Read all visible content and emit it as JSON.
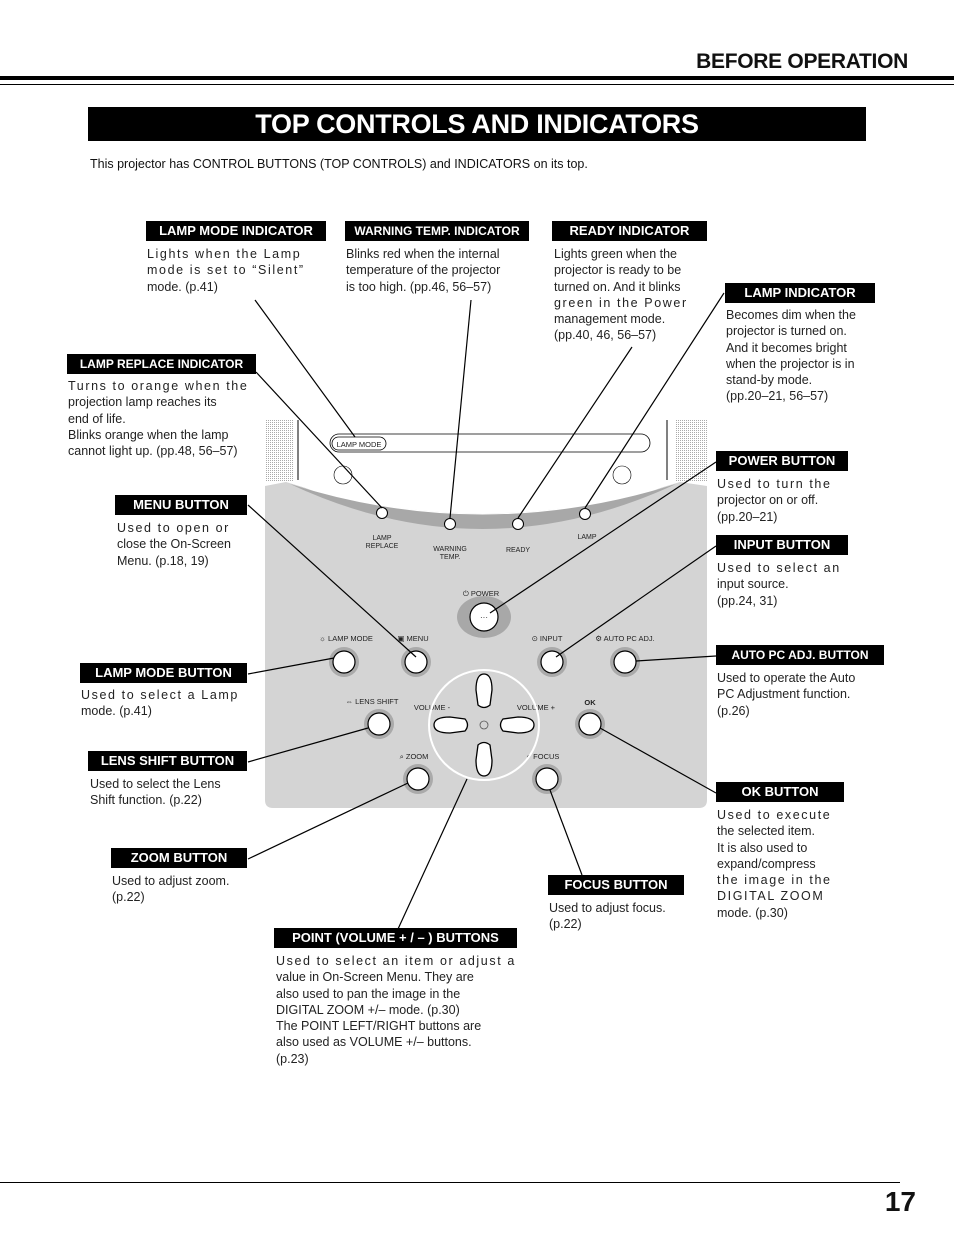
{
  "header": {
    "section": "BEFORE OPERATION"
  },
  "title": "TOP CONTROLS AND INDICATORS",
  "intro": "This projector has CONTROL BUTTONS (TOP CONTROLS) and INDICATORS on its top.",
  "callouts": {
    "lamp_mode_indicator": {
      "label": "LAMP MODE INDICATOR",
      "lines": [
        "Lights when the Lamp",
        "mode is set to “Silent”",
        "mode. (p.41)"
      ]
    },
    "warning_temp_indicator": {
      "label": "WARNING TEMP. INDICATOR",
      "lines": [
        "Blinks red when the internal",
        "temperature of the projector",
        "is too high. (pp.46, 56–57)"
      ]
    },
    "ready_indicator": {
      "label": "READY INDICATOR",
      "lines": [
        "Lights green when the",
        "projector is ready to be",
        "turned on. And it blinks",
        "green in the Power",
        "management mode.",
        "(pp.40, 46, 56–57)"
      ]
    },
    "lamp_indicator": {
      "label": "LAMP INDICATOR",
      "lines": [
        "Becomes dim when the",
        "projector is turned on.",
        "And it becomes bright",
        "when the projector is in",
        "stand-by mode.",
        "(pp.20–21, 56–57)"
      ]
    },
    "lamp_replace_indicator": {
      "label": "LAMP REPLACE INDICATOR",
      "lines": [
        "Turns to orange when the",
        "projection lamp reaches its",
        "end of life.",
        "Blinks orange when the lamp",
        "cannot light up. (pp.48, 56–57)"
      ]
    },
    "menu_button": {
      "label": "MENU BUTTON",
      "lines": [
        "Used to open or",
        "close the On-Screen",
        "Menu. (p.18, 19)"
      ]
    },
    "power_button": {
      "label": "POWER BUTTON",
      "lines": [
        "Used to turn the",
        "projector on or off.",
        "(pp.20–21)"
      ]
    },
    "input_button": {
      "label": "INPUT BUTTON",
      "lines": [
        "Used to select an",
        "input source.",
        "(pp.24, 31)"
      ]
    },
    "lamp_mode_button": {
      "label": "LAMP MODE BUTTON",
      "lines": [
        "Used to select a Lamp",
        "mode. (p.41)"
      ]
    },
    "auto_pc_adj_button": {
      "label": "AUTO PC ADJ. BUTTON",
      "lines": [
        "Used to operate the Auto",
        "PC Adjustment function.",
        "(p.26)"
      ]
    },
    "lens_shift_button": {
      "label": "LENS SHIFT BUTTON",
      "lines": [
        "Used to select the Lens",
        "Shift function. (p.22)"
      ]
    },
    "ok_button": {
      "label": "OK BUTTON",
      "lines": [
        "Used to execute",
        "the selected item.",
        "It is also used to",
        "expand/compress",
        "the image in the",
        "DIGITAL ZOOM",
        "mode. (p.30)"
      ]
    },
    "zoom_button": {
      "label": "ZOOM BUTTON",
      "lines": [
        "Used to adjust zoom.",
        "(p.22)"
      ]
    },
    "focus_button": {
      "label": "FOCUS BUTTON",
      "lines": [
        "Used to adjust focus.",
        "(p.22)"
      ]
    },
    "point_buttons": {
      "label": "POINT (VOLUME + / – ) BUTTONS",
      "lines": [
        "Used to select an item or adjust a",
        "value in On-Screen Menu. They are",
        "also used to pan the image in the",
        "DIGITAL ZOOM +/– mode. (p.30)",
        "The POINT LEFT/RIGHT buttons are",
        "also used as VOLUME +/– buttons.",
        "(p.23)"
      ]
    }
  },
  "panel": {
    "lamp_mode_badge": "LAMP MODE",
    "indicators": {
      "lamp_replace": [
        "LAMP",
        "REPLACE"
      ],
      "warning_temp": [
        "WARNING",
        "TEMP."
      ],
      "ready": "READY",
      "lamp": "LAMP"
    },
    "buttons": {
      "power": "⏻ POWER",
      "lamp_mode": "☼ LAMP MODE",
      "menu": "▣ MENU",
      "input": "⊙ INPUT",
      "auto_pc_adj": "⚙ AUTO PC ADJ.",
      "lens_shift": "⇔ LENS SHIFT",
      "ok": "OK",
      "zoom": "⌕ ZOOM",
      "focus": "◐ FOCUS",
      "volume_minus": "VOLUME -",
      "volume_plus": "VOLUME +"
    },
    "colors": {
      "panel_bg": "#d4d4d4",
      "indicator_band": "#a8a8a8",
      "button_ring": "#aaaaaa"
    }
  },
  "footer": {
    "page_number": "17"
  }
}
